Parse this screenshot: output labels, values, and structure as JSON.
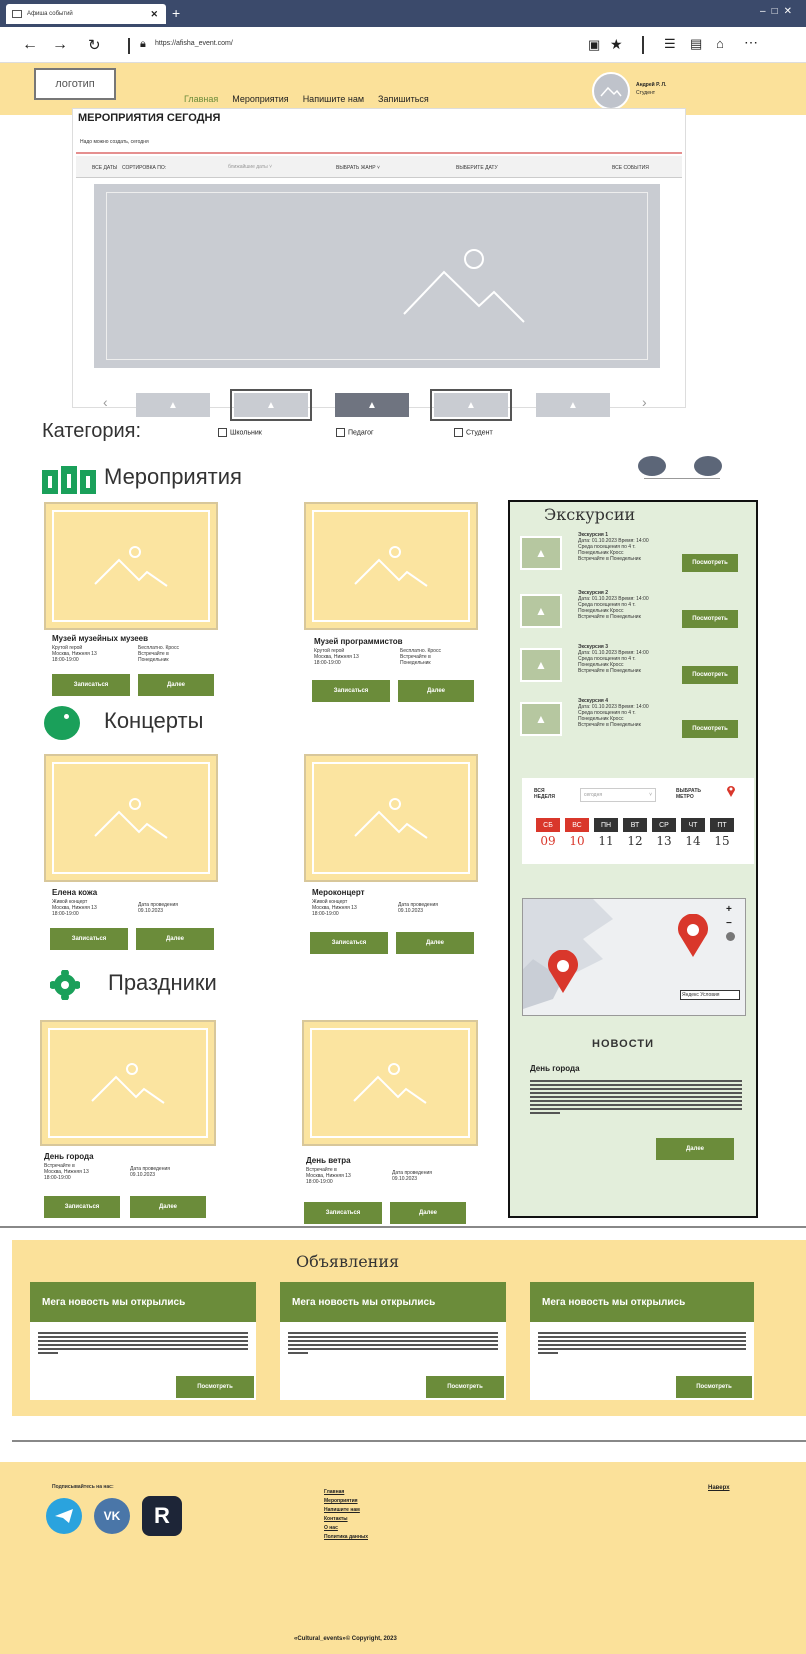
{
  "browser": {
    "tab_title": "Афиша событий",
    "url": "https://afisha_event.com/",
    "window_controls": [
      "–",
      "□",
      "✕"
    ]
  },
  "header": {
    "logo": "логотип",
    "nav": [
      "Главная",
      "Мероприятия",
      "Напишите нам",
      "Запишиться"
    ],
    "user_name": "Андрей Р. Л.",
    "user_role": "Студент"
  },
  "hero": {
    "title": "Мероприятия сегодня",
    "subtitle": "Надо можно создать, сегодня",
    "filters": {
      "all_dates": "ВСЕ ДАТЫ",
      "sort_label": "СОРТИРОВКА ПО:",
      "sort_value": "ближайшие даты",
      "genre": "ВЫБРАТЬ ЖАНР",
      "date": "ВЫБЕРИТЕ ДАТУ",
      "all_events": "ВСЕ СОБЫТИЯ"
    },
    "prev": "‹",
    "next": "›"
  },
  "categories": {
    "label": "Категория:",
    "options": [
      "Школьник",
      "Педагог",
      "Студент"
    ]
  },
  "sections": {
    "events": {
      "title": "Мероприятия",
      "cards": [
        {
          "name": "Музей музейных музеев",
          "meta1": "Крутой герой",
          "meta2": "Москва, Нижняя 13",
          "meta3": "18:00-19:00",
          "meta4": "Бесплатно. Кросс",
          "meta5": "Встречайте в",
          "meta6": "Понедельник"
        },
        {
          "name": "Музей программистов",
          "meta1": "Крутой герой",
          "meta2": "Москва, Нижняя 13",
          "meta3": "18:00-19:00",
          "meta4": "Бесплатно. Кросс",
          "meta5": "Встречайте в",
          "meta6": "Понедельник"
        }
      ]
    },
    "concerts": {
      "title": "Концерты",
      "cards": [
        {
          "name": "Елена кожа",
          "meta1": "Живой концерт",
          "meta2": "Москва, Нижняя 13",
          "meta3": "18:00-19:00",
          "meta4": "Дата проведения",
          "meta5": "09.10.2023"
        },
        {
          "name": "Мероконцерт",
          "meta1": "Живой концерт",
          "meta2": "Москва, Нижняя 13",
          "meta3": "18:00-19:00",
          "meta4": "Дата проведения",
          "meta5": "09.10.2023"
        }
      ]
    },
    "holidays": {
      "title": "Праздники",
      "cards": [
        {
          "name": "День города",
          "meta1": "Встречайте в",
          "meta2": "Москва, Нижняя 13",
          "meta3": "18:00-19:00",
          "meta4": "Дата проведения",
          "meta5": "09.10.2023"
        },
        {
          "name": "День ветра",
          "meta1": "Встречайте в",
          "meta2": "Москва, Нижняя 13",
          "meta3": "18:00-19:00",
          "meta4": "Дата проведения",
          "meta5": "09.10.2023"
        }
      ]
    },
    "btn_signup": "Записаться",
    "btn_more": "Далее"
  },
  "sidebar": {
    "excursions_title": "Экскурсии",
    "excursions": [
      {
        "name": "Экскурсия 1",
        "l1": "Дата: 01.10.2023 Время: 14:00",
        "l2": "Среда посещения по 4 т.",
        "l3": "Понедельник Кросс",
        "l4": "Встречайте в Понедельник"
      },
      {
        "name": "Экскурсия 2",
        "l1": "Дата: 01.10.2023 Время: 14:00",
        "l2": "Среда посещения по 4 т.",
        "l3": "Понедельник Кросс",
        "l4": "Встречайте в Понедельник"
      },
      {
        "name": "Экскурсия 3",
        "l1": "Дата: 01.10.2023 Время: 14:00",
        "l2": "Среда посещения по 4 т.",
        "l3": "Понедельник Кросс",
        "l4": "Встречайте в Понедельник"
      },
      {
        "name": "Экскурсия 4",
        "l1": "Дата: 01.10.2023 Время: 14:00",
        "l2": "Среда посещения по 4 т.",
        "l3": "Понедельник Кросс",
        "l4": "Встречайте в Понедельник"
      }
    ],
    "view_btn": "Посмотреть",
    "calendar": {
      "label1": "ВСЯ",
      "label2": "НЕДЕЛЯ",
      "select": "сегодня",
      "metro1": "ВЫБРАТЬ",
      "metro2": "МЕТРО",
      "days": [
        "СБ",
        "ВС",
        "ПН",
        "ВТ",
        "СР",
        "ЧТ",
        "ПТ"
      ],
      "dates": [
        "09",
        "10",
        "11",
        "12",
        "13",
        "14",
        "15"
      ],
      "weekend_color": "#d9372b",
      "weekday_color": "#333333"
    },
    "map": {
      "zoom_in": "+",
      "zoom_out": "−",
      "scale1": "Яндекс",
      "scale2": "Условия"
    },
    "news_title": "НОВОСТИ",
    "news_item_title": "День города",
    "news_btn": "Далее"
  },
  "announcements": {
    "title": "Объявления",
    "cards": [
      {
        "title": "Мега новость мы открылись",
        "btn": "Посмотреть"
      },
      {
        "title": "Мега новость мы открылись",
        "btn": "Посмотреть"
      },
      {
        "title": "Мега новость мы открылись",
        "btn": "Посмотреть"
      }
    ]
  },
  "footer": {
    "subscribe": "Подписывайтесь на нас:",
    "links": [
      "Главная",
      "Мероприятия",
      "Напишите нам",
      "Контакты",
      "О нас",
      "Политика данных"
    ],
    "top_link": "Наверх",
    "copyright": "«Cultural_events»© Copyright, 2023"
  },
  "colors": {
    "accent_green": "#6b8c3a",
    "header_yellow": "#fbe19a",
    "sidebar_green": "#e3eedb",
    "placeholder_yellow": "#fbe4a0"
  }
}
